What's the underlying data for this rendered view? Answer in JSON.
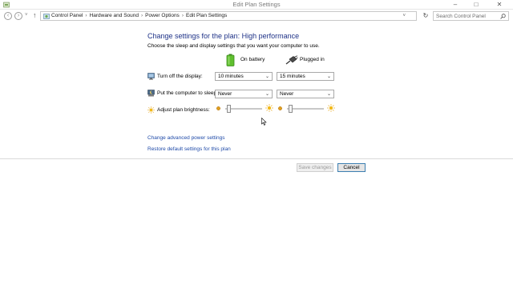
{
  "window": {
    "title": "Edit Plan Settings",
    "controls": {
      "minimize": "–",
      "maximize": "□",
      "close": "✕"
    }
  },
  "nav": {
    "back": "‹",
    "forward": "›",
    "dropdown": "˅",
    "up": "↑",
    "breadcrumbs": [
      "Control Panel",
      "Hardware and Sound",
      "Power Options",
      "Edit Plan Settings"
    ],
    "separator": "›",
    "address_dropdown": "˅",
    "refresh": "↻",
    "search_placeholder": "Search Control Panel"
  },
  "content": {
    "heading": "Change settings for the plan: High performance",
    "subtext": "Choose the sleep and display settings that you want your computer to use.",
    "columns": {
      "battery": "On battery",
      "plugged": "Plugged in"
    },
    "rows": {
      "display": {
        "label": "Turn off the display:",
        "battery": "10 minutes",
        "plugged": "15 minutes"
      },
      "sleep": {
        "label": "Put the computer to sleep:",
        "battery": "Never",
        "plugged": "Never"
      },
      "brightness": {
        "label": "Adjust plan brightness:",
        "battery_level_pct": 5,
        "plugged_level_pct": 5
      }
    },
    "select_arrow": "⌄",
    "links": {
      "advanced": "Change advanced power settings",
      "restore": "Restore default settings for this plan"
    }
  },
  "footer": {
    "save_label": "Save changes",
    "cancel_label": "Cancel"
  },
  "colors": {
    "heading": "#1e3287",
    "link": "#1f4aa8",
    "battery_green": "#5fbf2e",
    "brightness_yellow": "#f2b91a"
  }
}
